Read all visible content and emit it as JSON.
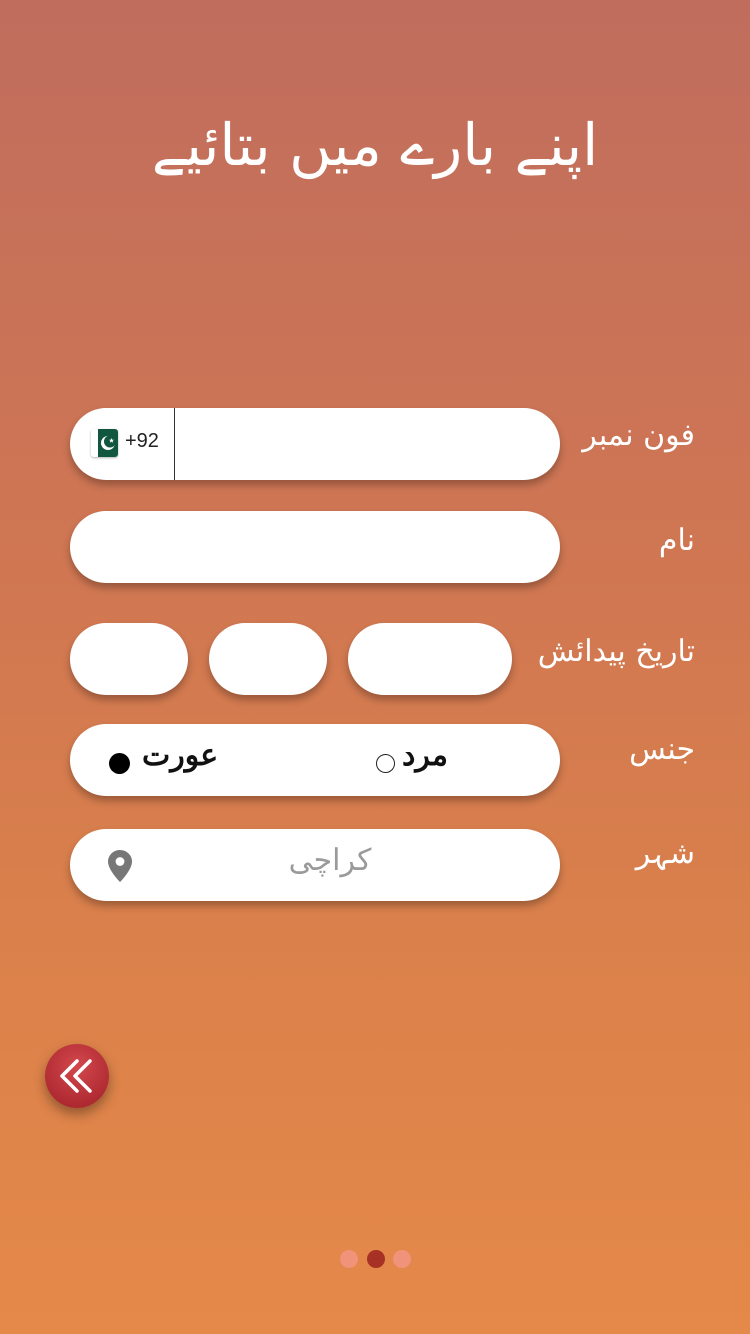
{
  "header": {
    "title": "اپنے بارے میں بتائیے"
  },
  "form": {
    "phone": {
      "label": "فون نمبر",
      "country_code": "+92",
      "flag_icon": "pakistan-flag-icon",
      "value": ""
    },
    "name": {
      "label": "نام",
      "value": ""
    },
    "dob": {
      "label": "تاریخ پیدائش",
      "day": "",
      "month": "",
      "year": ""
    },
    "gender": {
      "label": "جنس",
      "options": [
        {
          "label": "مرد",
          "selected": false
        },
        {
          "label": "عورت",
          "selected": true
        }
      ]
    },
    "city": {
      "label": "شہر",
      "value": "کراچی",
      "icon": "location-pin-icon"
    }
  },
  "navigation": {
    "back_icon": "double-chevron-left-icon",
    "page_indicator": {
      "total": 3,
      "current": 2
    }
  },
  "colors": {
    "background_top": "#c06d5e",
    "background_bottom": "#e5894a",
    "back_button": "#b12b33",
    "dot_active": "#a83126",
    "dot_inactive": "#f0937a",
    "flag_green": "#115740"
  }
}
